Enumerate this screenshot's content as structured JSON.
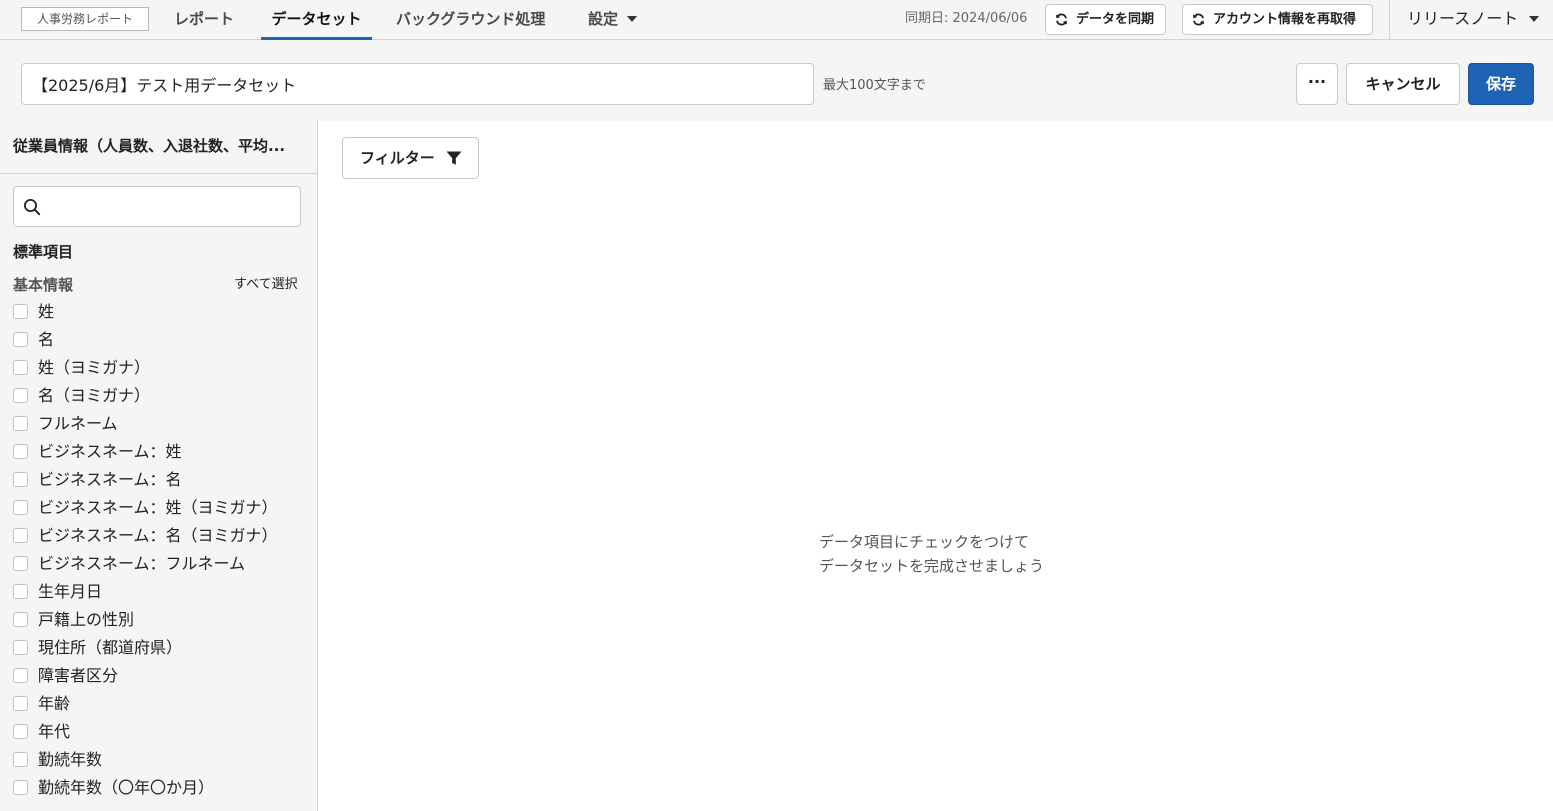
{
  "nav": {
    "brand": "人事労務レポート",
    "tabs": [
      "レポート",
      "データセット",
      "バックグラウンド処理",
      "設定"
    ],
    "active_tab": "データセット",
    "sync_date": "同期日: 2024/06/06",
    "sync_button": "データを同期",
    "refetch_button": "アカウント情報を再取得",
    "release_notes": "リリースノート"
  },
  "header": {
    "title_value": "【2025/6月】テスト用データセット",
    "title_hint": "最大100文字まで",
    "more_label": "···",
    "cancel_label": "キャンセル",
    "save_label": "保存",
    "accent_color": "#1f63b5"
  },
  "sidebar": {
    "title": "従業員情報（人員数、入退社数、平均...",
    "search_placeholder": "",
    "section_label": "標準項目",
    "group_label": "基本情報",
    "select_all": "すべて選択",
    "fields": [
      "姓",
      "名",
      "姓（ヨミガナ）",
      "名（ヨミガナ）",
      "フルネーム",
      "ビジネスネーム：姓",
      "ビジネスネーム：名",
      "ビジネスネーム：姓（ヨミガナ）",
      "ビジネスネーム：名（ヨミガナ）",
      "ビジネスネーム：フルネーム",
      "生年月日",
      "戸籍上の性別",
      "現住所（都道府県）",
      "障害者区分",
      "年齢",
      "年代",
      "勤続年数",
      "勤続年数（〇年〇か月）"
    ]
  },
  "main": {
    "filter_label": "フィルター",
    "empty_line1": "データ項目にチェックをつけて",
    "empty_line2": "データセットを完成させましょう"
  }
}
